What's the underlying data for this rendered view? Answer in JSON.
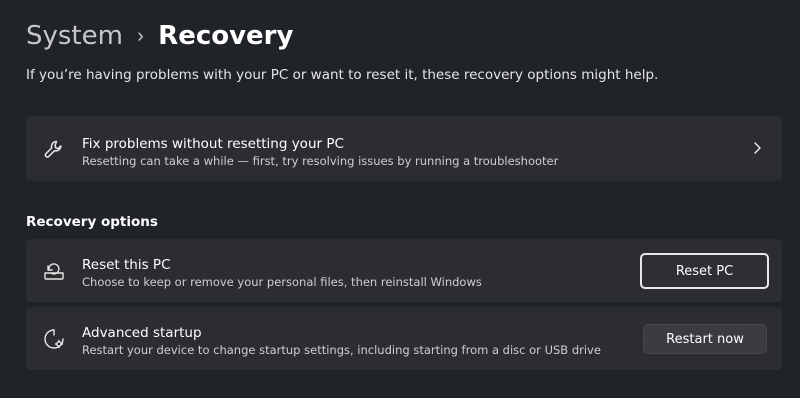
{
  "breadcrumb": {
    "parent": "System",
    "separator": "›",
    "current": "Recovery"
  },
  "intro": "If you’re having problems with your PC or want to reset it, these recovery options might help.",
  "fix_card": {
    "icon": "wrench-icon",
    "title": "Fix problems without resetting your PC",
    "subtitle": "Resetting can take a while — first, try resolving issues by running a troubleshooter",
    "chevron_icon": "chevron-right-icon"
  },
  "recovery_options": {
    "heading": "Recovery options",
    "reset": {
      "icon": "reset-pc-icon",
      "title": "Reset this PC",
      "subtitle": "Choose to keep or remove your personal files, then reinstall Windows",
      "button_label": "Reset PC"
    },
    "advanced": {
      "icon": "advanced-startup-icon",
      "title": "Advanced startup",
      "subtitle": "Restart your device to change startup settings, including starting from a disc or USB drive",
      "button_label": "Restart now"
    }
  },
  "colors": {
    "background": "#202327",
    "card": "#2b2d31",
    "text_primary": "#ffffff",
    "text_secondary": "#cfcfcf"
  }
}
